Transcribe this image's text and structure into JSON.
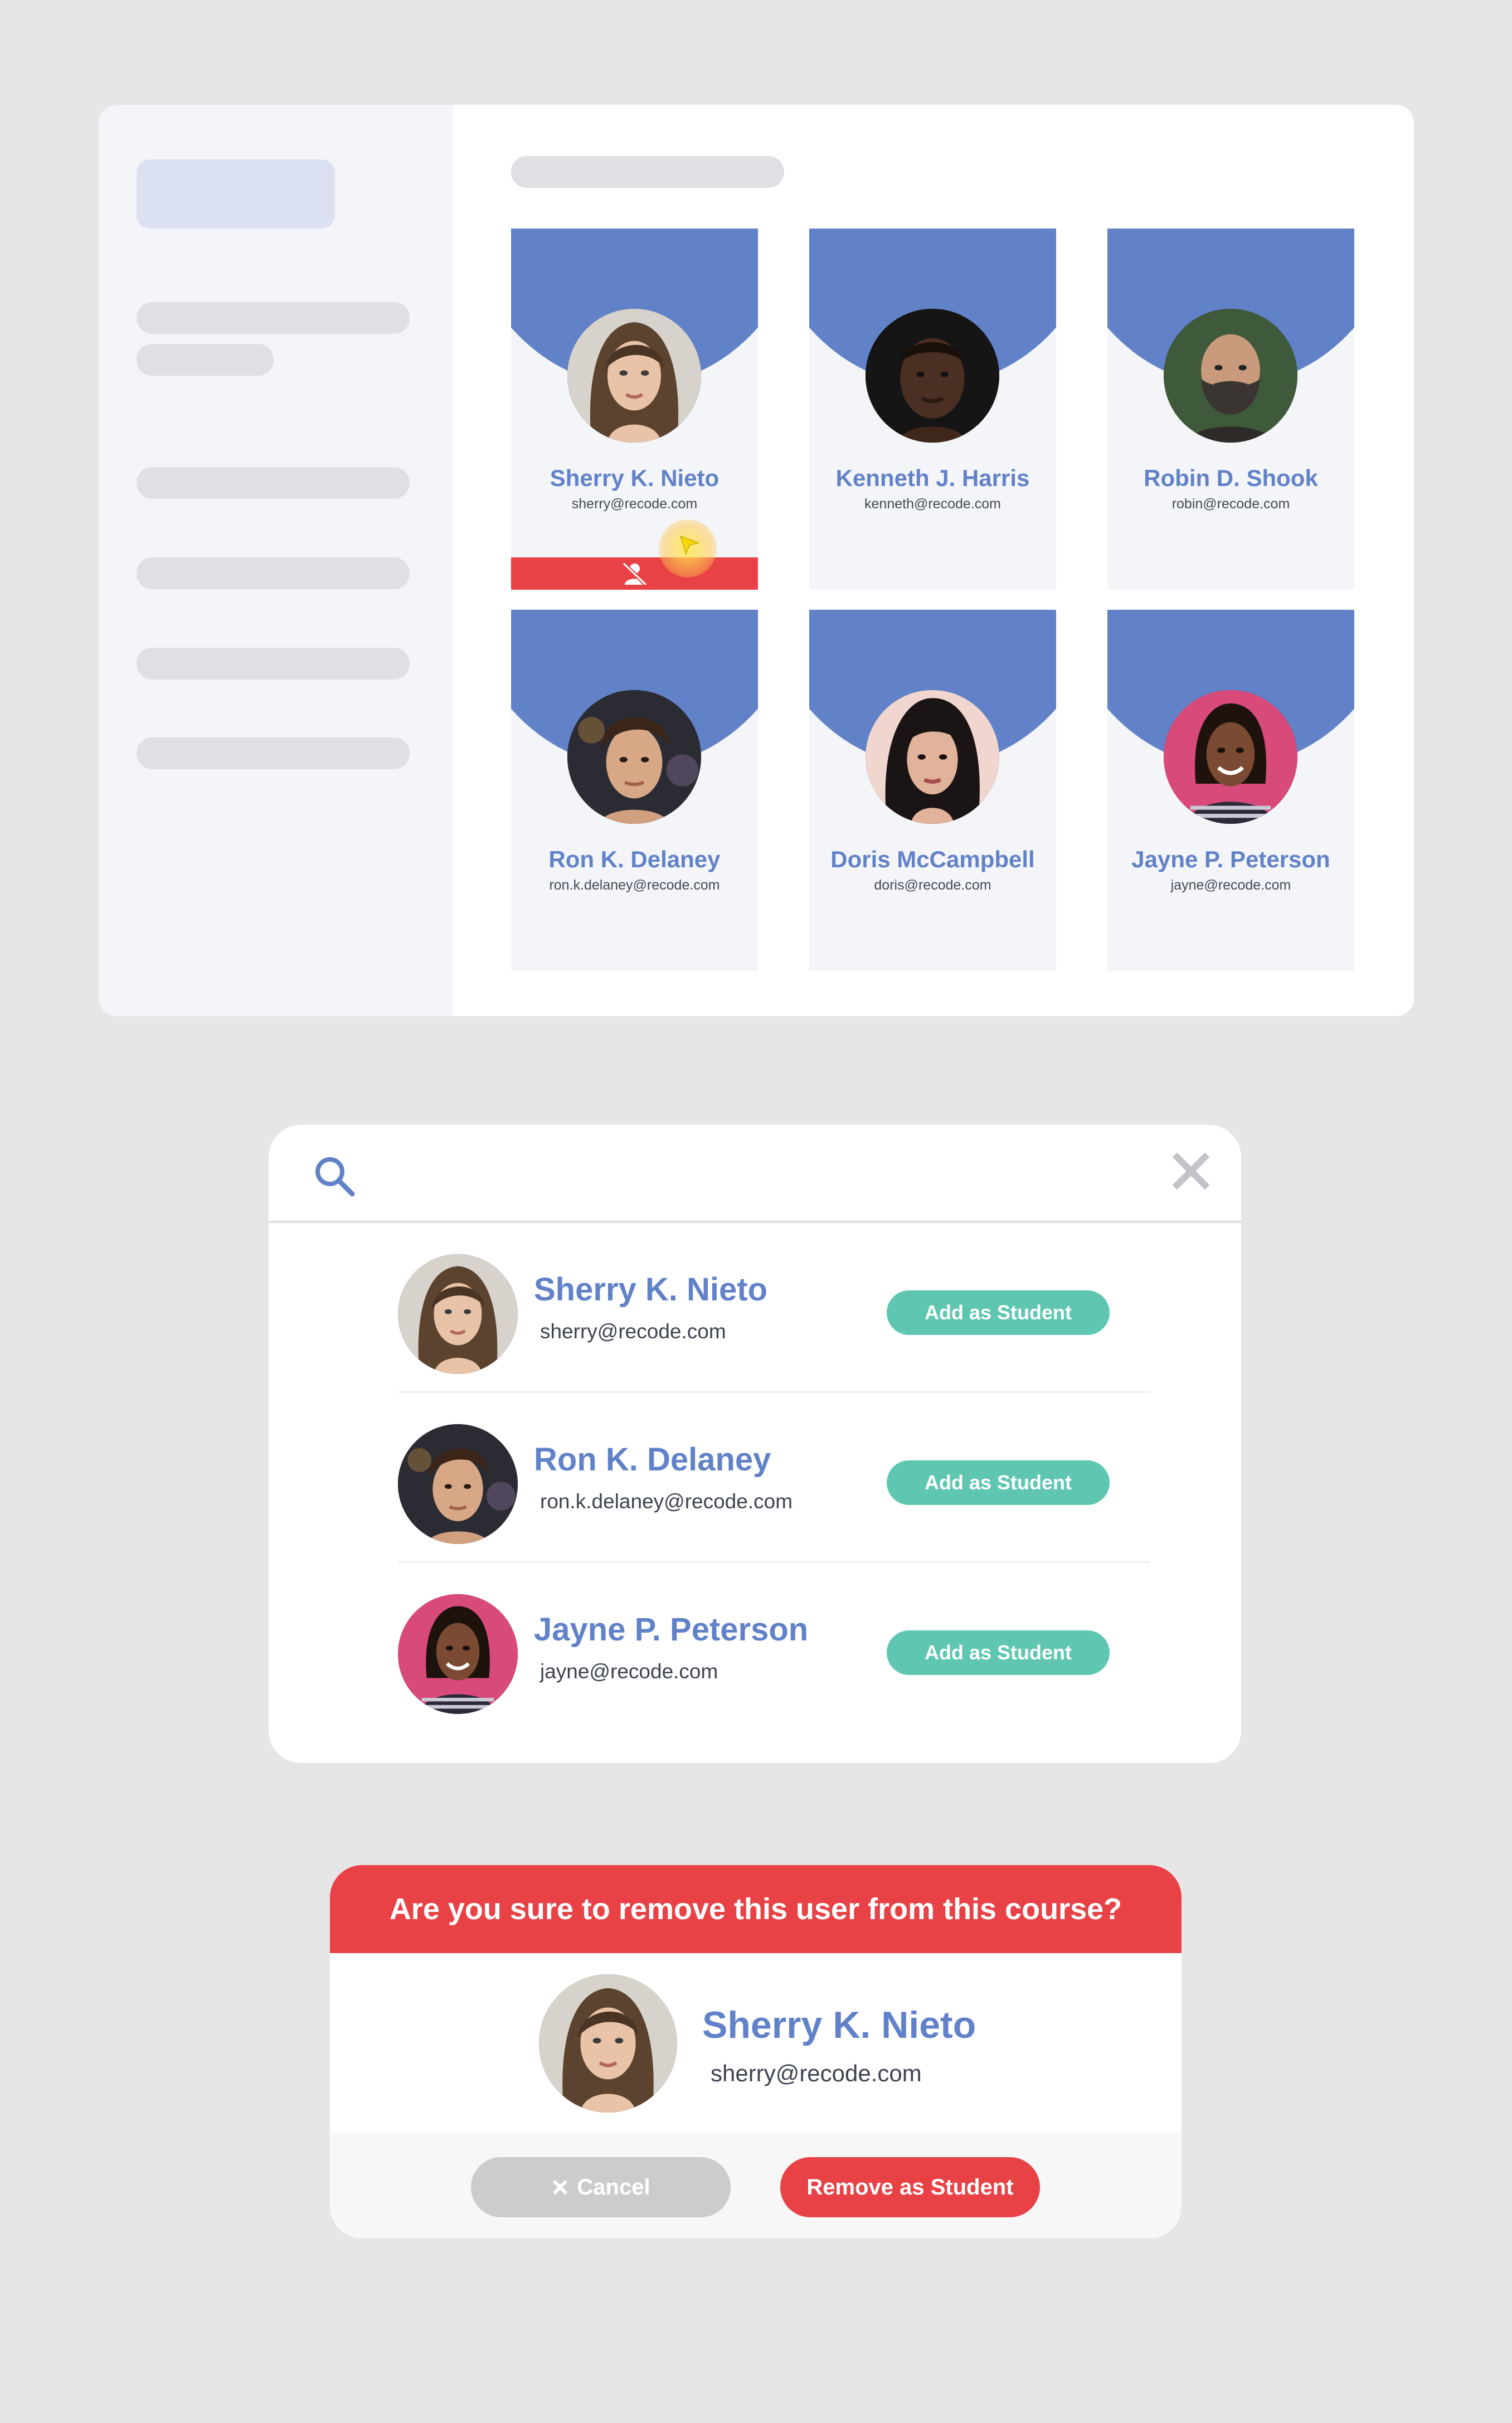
{
  "colors": {
    "background": "#e6e6e6",
    "brand_blue": "#6182c8",
    "danger_red": "#e84246",
    "add_green": "#5fc7b1",
    "cancel_gray": "#cccccc"
  },
  "dashboard": {
    "students": [
      {
        "name": "Sherry K. Nieto",
        "email": "sherry@recode.com",
        "remove_icon": "remove-user-icon"
      },
      {
        "name": "Kenneth J. Harris",
        "email": "kenneth@recode.com"
      },
      {
        "name": "Robin D. Shook",
        "email": "robin@recode.com"
      },
      {
        "name": "Ron K. Delaney",
        "email": "ron.k.delaney@recode.com"
      },
      {
        "name": "Doris McCampbell",
        "email": "doris@recode.com"
      },
      {
        "name": "Jayne P. Peterson",
        "email": "jayne@recode.com"
      }
    ]
  },
  "search": {
    "query": "",
    "icon": "search-icon",
    "close_icon": "close-icon",
    "results": [
      {
        "name": "Sherry K. Nieto",
        "email": "sherry@recode.com",
        "action": "Add as Student"
      },
      {
        "name": "Ron K. Delaney",
        "email": "ron.k.delaney@recode.com",
        "action": "Add as Student"
      },
      {
        "name": "Jayne P. Peterson",
        "email": "jayne@recode.com",
        "action": "Add as Student"
      }
    ]
  },
  "confirm": {
    "title": "Are you sure to remove this user from this course?",
    "name": "Sherry K. Nieto",
    "email": "sherry@recode.com",
    "cancel_label": "Cancel",
    "remove_label": "Remove as Student"
  }
}
